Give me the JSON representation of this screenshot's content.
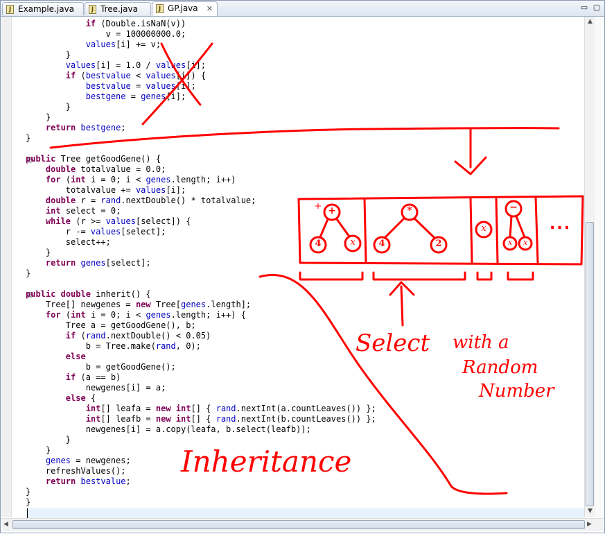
{
  "tabs": [
    {
      "label": "Example.java",
      "active": false
    },
    {
      "label": "Tree.java",
      "active": false
    },
    {
      "label": "GP.java",
      "active": true,
      "close_icon": "✕"
    }
  ],
  "window_buttons": {
    "minimize": "▭",
    "maximize": "▢"
  },
  "code_lines": [
    "            if (Double.isNaN(v))",
    "                v = 100000000.0;",
    "            values[i] += v;",
    "        }",
    "        values[i] = 1.0 / values[i];",
    "        if (bestvalue < values[i]) {",
    "            bestvalue = values[i];",
    "            bestgene = genes[i];",
    "        }",
    "    }",
    "    return bestgene;",
    "}",
    "",
    "public Tree getGoodGene() {",
    "    double totalvalue = 0.0;",
    "    for (int i = 0; i < genes.length; i++)",
    "        totalvalue += values[i];",
    "    double r = rand.nextDouble() * totalvalue;",
    "    int select = 0;",
    "    while (r >= values[select]) {",
    "        r -= values[select];",
    "        select++;",
    "    }",
    "    return genes[select];",
    "}",
    "",
    "public double inherit() {",
    "    Tree[] newgenes = new Tree[genes.length];",
    "    for (int i = 0; i < genes.length; i++) {",
    "        Tree a = getGoodGene(), b;",
    "        if (rand.nextDouble() < 0.05)",
    "            b = Tree.make(rand, 0);",
    "        else",
    "            b = getGoodGene();",
    "        if (a == b)",
    "            newgenes[i] = a;",
    "        else {",
    "            int[] leafa = new int[] { rand.nextInt(a.countLeaves()) };",
    "            int[] leafb = new int[] { rand.nextInt(b.countLeaves()) };",
    "            newgenes[i] = a.copy(leafa, b.select(leafb));",
    "        }",
    "    }",
    "    genes = newgenes;",
    "    refreshValues();",
    "    return bestvalue;",
    "}",
    "}",
    ""
  ],
  "fold_markers": [
    "⊖",
    "⊖"
  ],
  "scroll_arrows": {
    "up": "▲",
    "down": "▼",
    "left": "◀",
    "right": "▶"
  },
  "annotations": {
    "select_label_1": "Select",
    "select_label_2": "with a",
    "select_label_3": "Random",
    "select_label_4": "Number",
    "inheritance_label": "Inheritance",
    "tree_nodes": [
      "+",
      "4",
      "x",
      "*",
      "4",
      "2",
      "x",
      "−",
      "x",
      "x"
    ],
    "ellipsis": "..."
  },
  "colors": {
    "ink": "#ff0000",
    "keyword": "#7f0055",
    "field": "#0000c0",
    "cursor_line": "#e8f2fe"
  }
}
